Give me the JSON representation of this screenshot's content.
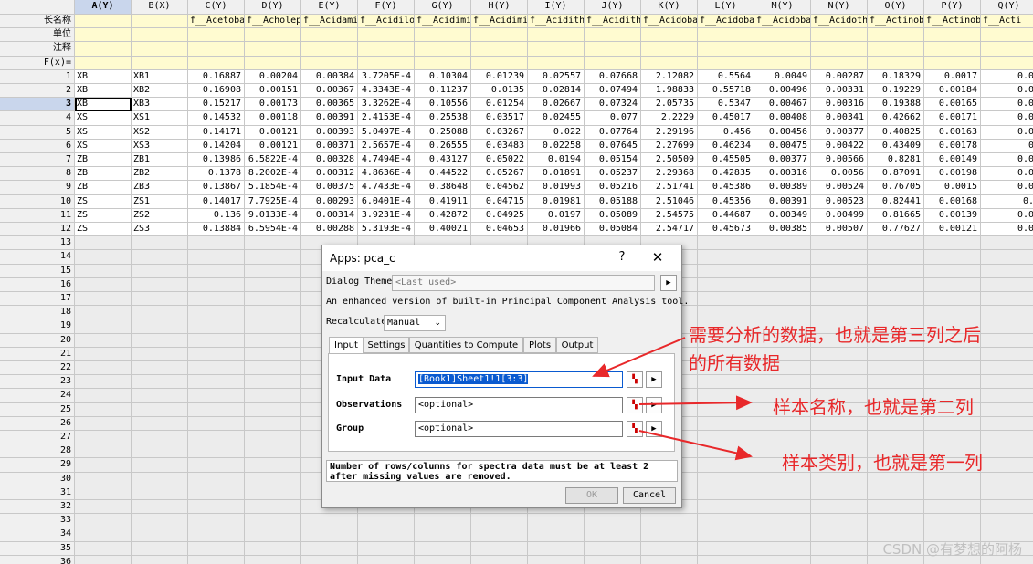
{
  "sheet": {
    "columns": [
      {
        "label": "A(Y)",
        "width": 62
      },
      {
        "label": "B(X)",
        "width": 62
      },
      {
        "label": "C(Y)",
        "width": 62
      },
      {
        "label": "D(Y)",
        "width": 62
      },
      {
        "label": "E(Y)",
        "width": 62
      },
      {
        "label": "F(Y)",
        "width": 62
      },
      {
        "label": "G(Y)",
        "width": 62
      },
      {
        "label": "H(Y)",
        "width": 62
      },
      {
        "label": "I(Y)",
        "width": 62
      },
      {
        "label": "J(Y)",
        "width": 62
      },
      {
        "label": "K(Y)",
        "width": 62
      },
      {
        "label": "L(Y)",
        "width": 62
      },
      {
        "label": "M(Y)",
        "width": 62
      },
      {
        "label": "N(Y)",
        "width": 62
      },
      {
        "label": "O(Y)",
        "width": 62
      },
      {
        "label": "P(Y)",
        "width": 62
      },
      {
        "label": "Q(Y)",
        "width": 62
      }
    ],
    "meta_rows": [
      "长名称",
      "单位",
      "注释",
      "F(x)="
    ],
    "long_names": [
      "",
      "",
      "f__Acetoba",
      "f__Acholep",
      "f__Acidami",
      "f__Acidilo",
      "f__Acidimi",
      "f__Acidimi",
      "f__Acidith",
      "f__Acidith",
      "f__Acidoba",
      "f__Acidoba",
      "f__Acidoba",
      "f__Acidoth",
      "f__Actinob",
      "f__Actinob",
      "f__Acti"
    ],
    "rows": [
      [
        "XB",
        "XB1",
        "0.16887",
        "0.00204",
        "0.00384",
        "3.7205E-4",
        "0.10304",
        "0.01239",
        "0.02557",
        "0.07668",
        "2.12082",
        "0.5564",
        "0.0049",
        "0.00287",
        "0.18329",
        "0.0017",
        "0.0"
      ],
      [
        "XB",
        "XB2",
        "0.16908",
        "0.00151",
        "0.00367",
        "4.3343E-4",
        "0.11237",
        "0.0135",
        "0.02814",
        "0.07494",
        "1.98833",
        "0.55718",
        "0.00496",
        "0.00331",
        "0.19229",
        "0.00184",
        "0.0"
      ],
      [
        "XB",
        "XB3",
        "0.15217",
        "0.00173",
        "0.00365",
        "3.3262E-4",
        "0.10556",
        "0.01254",
        "0.02667",
        "0.07324",
        "2.05735",
        "0.5347",
        "0.00467",
        "0.00316",
        "0.19388",
        "0.00165",
        "0.0"
      ],
      [
        "XS",
        "XS1",
        "0.14532",
        "0.00118",
        "0.00391",
        "2.4153E-4",
        "0.25538",
        "0.03517",
        "0.02455",
        "0.077",
        "2.2229",
        "0.45017",
        "0.00408",
        "0.00341",
        "0.42662",
        "0.00171",
        "0.0"
      ],
      [
        "XS",
        "XS2",
        "0.14171",
        "0.00121",
        "0.00393",
        "5.0497E-4",
        "0.25088",
        "0.03267",
        "0.022",
        "0.07764",
        "2.29196",
        "0.456",
        "0.00456",
        "0.00377",
        "0.40825",
        "0.00163",
        "0.0"
      ],
      [
        "XS",
        "XS3",
        "0.14204",
        "0.00121",
        "0.00371",
        "2.5657E-4",
        "0.26555",
        "0.03483",
        "0.02258",
        "0.07645",
        "2.27699",
        "0.46234",
        "0.00475",
        "0.00422",
        "0.43409",
        "0.00178",
        "0"
      ],
      [
        "ZB",
        "ZB1",
        "0.13986",
        "6.5822E-4",
        "0.00328",
        "4.7494E-4",
        "0.43127",
        "0.05022",
        "0.0194",
        "0.05154",
        "2.50509",
        "0.45505",
        "0.00377",
        "0.00566",
        "0.8281",
        "0.00149",
        "0.0"
      ],
      [
        "ZB",
        "ZB2",
        "0.1378",
        "8.2002E-4",
        "0.00312",
        "4.8636E-4",
        "0.44522",
        "0.05267",
        "0.01891",
        "0.05237",
        "2.29368",
        "0.42835",
        "0.00316",
        "0.0056",
        "0.87091",
        "0.00198",
        "0.0"
      ],
      [
        "ZB",
        "ZB3",
        "0.13867",
        "5.1854E-4",
        "0.00375",
        "4.7433E-4",
        "0.38648",
        "0.04562",
        "0.01993",
        "0.05216",
        "2.51741",
        "0.45386",
        "0.00389",
        "0.00524",
        "0.76705",
        "0.0015",
        "0.0"
      ],
      [
        "ZS",
        "ZS1",
        "0.14017",
        "7.7925E-4",
        "0.00293",
        "6.0401E-4",
        "0.41911",
        "0.04715",
        "0.01981",
        "0.05188",
        "2.51046",
        "0.45356",
        "0.00391",
        "0.00523",
        "0.82441",
        "0.00168",
        "0."
      ],
      [
        "ZS",
        "ZS2",
        "0.136",
        "9.0133E-4",
        "0.00314",
        "3.9231E-4",
        "0.42872",
        "0.04925",
        "0.0197",
        "0.05089",
        "2.54575",
        "0.44687",
        "0.00349",
        "0.00499",
        "0.81665",
        "0.00139",
        "0.0"
      ],
      [
        "ZS",
        "ZS3",
        "0.13884",
        "6.5954E-4",
        "0.00288",
        "5.3193E-4",
        "0.40021",
        "0.04653",
        "0.01966",
        "0.05084",
        "2.54717",
        "0.45673",
        "0.00385",
        "0.00507",
        "0.77627",
        "0.00121",
        "0.0"
      ]
    ],
    "row_count": 36
  },
  "dialog": {
    "title": "Apps: pca_c",
    "help": "?",
    "close": "✕",
    "theme_label": "Dialog Theme",
    "theme_value": "<Last used>",
    "description": "An enhanced version of built-in Principal Component Analysis tool.",
    "recalc_label": "Recalculate",
    "recalc_value": "Manual",
    "tabs": [
      "Input",
      "Settings",
      "Quantities to Compute",
      "Plots",
      "Output"
    ],
    "input_data_label": "Input Data",
    "input_data_value": "[Book1]Sheet1!1[3:3]",
    "observations_label": "Observations",
    "observations_value": "<optional>",
    "group_label": "Group",
    "group_value": "<optional>",
    "message": "Number of rows/columns for spectra data must be at least 2 after missing values are removed.",
    "ok": "OK",
    "cancel": "Cancel"
  },
  "annotations": {
    "a1_line1": "需要分析的数据，也就是第三列之后",
    "a1_line2": "的所有数据",
    "a2": "样本名称，也就是第二列",
    "a3": "样本类别，也就是第一列",
    "color": "#e8282a"
  },
  "watermark": "CSDN @有梦想的阿杨"
}
